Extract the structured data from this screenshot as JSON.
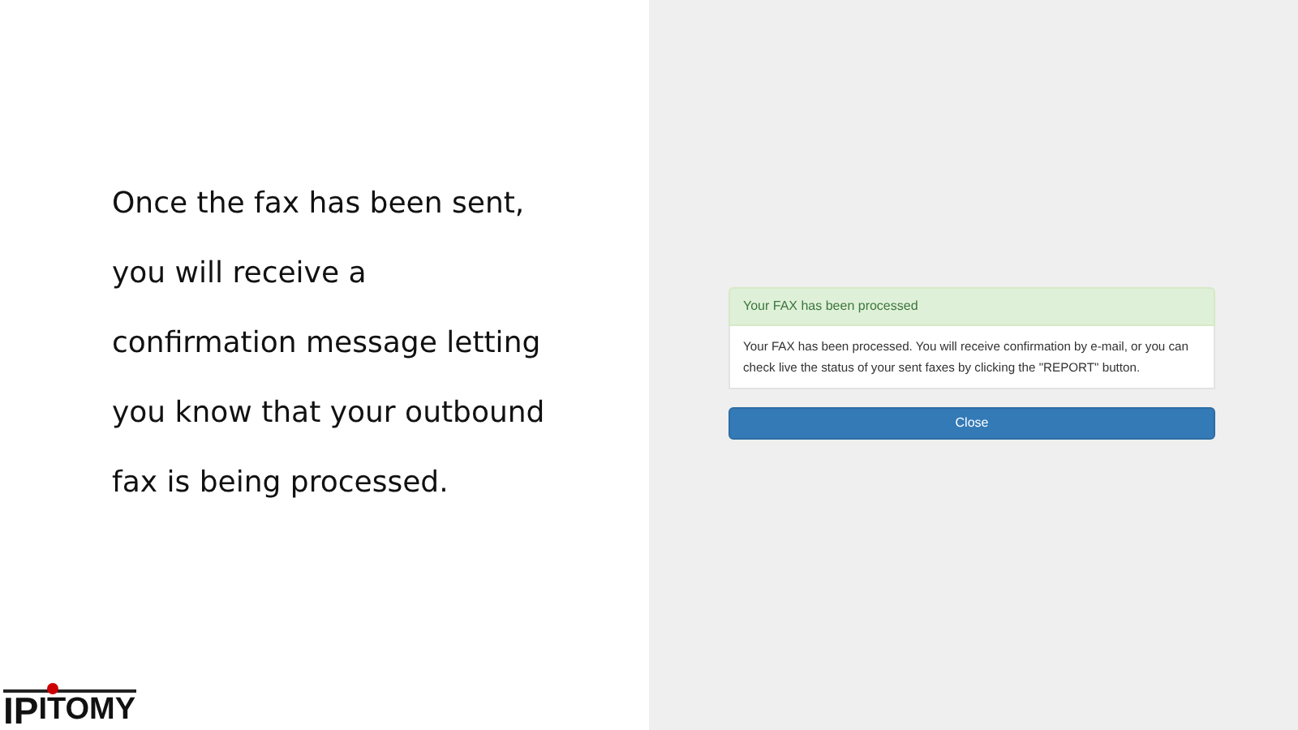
{
  "slide": {
    "text": "Once the fax has been sent, you will receive a confirmation message letting you know that your outbound fax is being processed."
  },
  "logo": {
    "lead": "IP",
    "rest": "ITOMY"
  },
  "panel": {
    "heading": "Your FAX has been processed",
    "body": "Your FAX has been processed. You will receive confirmation by e-mail, or you can check live the status of your sent faxes by clicking the \"REPORT\" button."
  },
  "buttons": [
    "Close"
  ]
}
